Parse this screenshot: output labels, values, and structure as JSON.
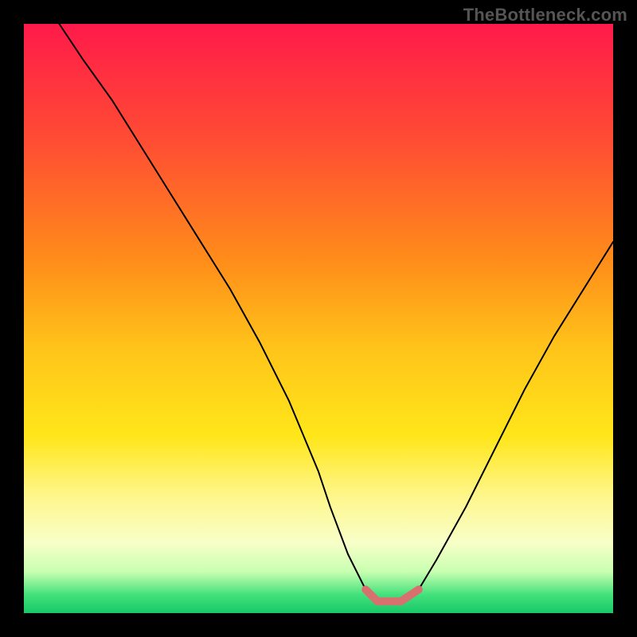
{
  "watermark": "TheBottleneck.com",
  "chart_data": {
    "type": "line",
    "title": "",
    "xlabel": "",
    "ylabel": "",
    "xlim": [
      0,
      100
    ],
    "ylim": [
      0,
      100
    ],
    "gradient_stops": [
      {
        "offset": 0,
        "color": "#ff1a4a"
      },
      {
        "offset": 20,
        "color": "#ff4d33"
      },
      {
        "offset": 40,
        "color": "#ff8c1a"
      },
      {
        "offset": 55,
        "color": "#ffc41a"
      },
      {
        "offset": 70,
        "color": "#ffe61a"
      },
      {
        "offset": 80,
        "color": "#fff68a"
      },
      {
        "offset": 88,
        "color": "#f8ffc8"
      },
      {
        "offset": 93,
        "color": "#c8ffb0"
      },
      {
        "offset": 97,
        "color": "#40e07a"
      },
      {
        "offset": 100,
        "color": "#18c868"
      }
    ],
    "series": [
      {
        "name": "curve",
        "color": "#000000",
        "width": 2,
        "x": [
          6,
          10,
          15,
          20,
          25,
          30,
          35,
          40,
          45,
          50,
          52,
          55,
          58,
          60,
          62,
          64,
          67,
          70,
          75,
          80,
          85,
          90,
          95,
          100
        ],
        "y": [
          100,
          94,
          87,
          79,
          71,
          63,
          55,
          46,
          36,
          24,
          18,
          10,
          4,
          2,
          2,
          2,
          4,
          9,
          18,
          28,
          38,
          47,
          55,
          63
        ]
      },
      {
        "name": "floor-highlight",
        "color": "#d97070",
        "width": 10,
        "x": [
          50,
          52,
          55,
          58,
          60,
          62,
          64,
          67
        ],
        "y": [
          24,
          18,
          10,
          4,
          2,
          2,
          2,
          4
        ],
        "only_below_y": 8
      }
    ]
  }
}
